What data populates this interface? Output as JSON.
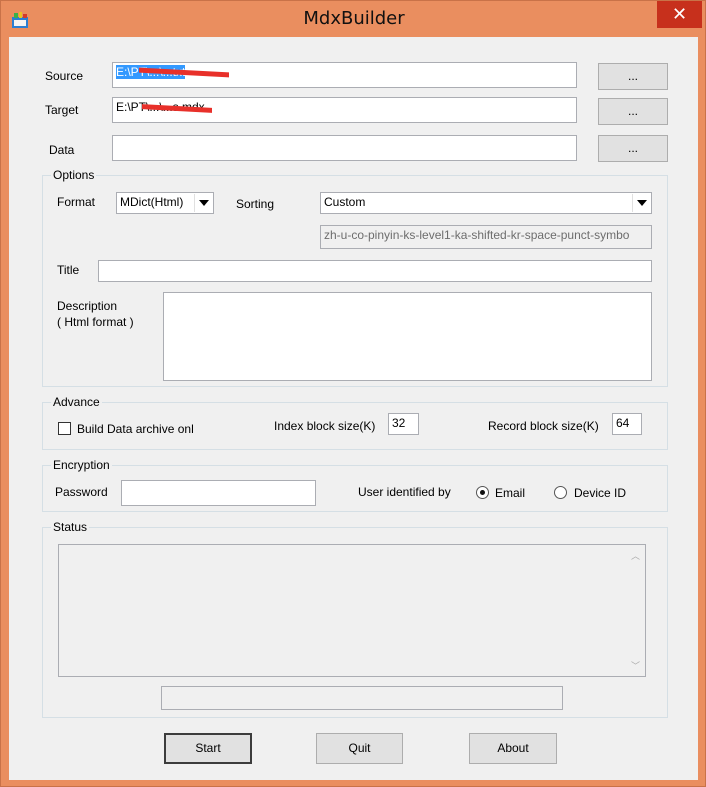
{
  "window": {
    "title": "MdxBuilder",
    "close_glyph": "✕"
  },
  "files": {
    "source_label": "Source",
    "source_value": "E:\\PT\\...\\...txt",
    "target_label": "Target",
    "target_value": "E:\\PT\\...\\...s.mdx",
    "data_label": "Data",
    "data_value": "",
    "browse_label": "..."
  },
  "options": {
    "group_label": "Options",
    "format_label": "Format",
    "format_value": "MDict(Html)",
    "sorting_label": "Sorting",
    "sorting_value": "Custom",
    "collation_value": "zh-u-co-pinyin-ks-level1-ka-shifted-kr-space-punct-symbo",
    "title_label": "Title",
    "title_value": "",
    "description_label": "Description",
    "description_sub": "( Html format )",
    "description_value": ""
  },
  "advance": {
    "group_label": "Advance",
    "build_data_label": "Build Data archive onl",
    "build_data_checked": false,
    "index_block_label": "Index block size(K)",
    "index_block_value": "32",
    "record_block_label": "Record block size(K)",
    "record_block_value": "64"
  },
  "encryption": {
    "group_label": "Encryption",
    "password_label": "Password",
    "password_value": "",
    "user_identified_label": "User identified by",
    "email_label": "Email",
    "device_id_label": "Device ID",
    "selected": "Email"
  },
  "status": {
    "group_label": "Status",
    "log_text": "",
    "scroll_up_glyph": "︿",
    "scroll_down_glyph": "﹀"
  },
  "actions": {
    "start_label": "Start",
    "quit_label": "Quit",
    "about_label": "About"
  }
}
